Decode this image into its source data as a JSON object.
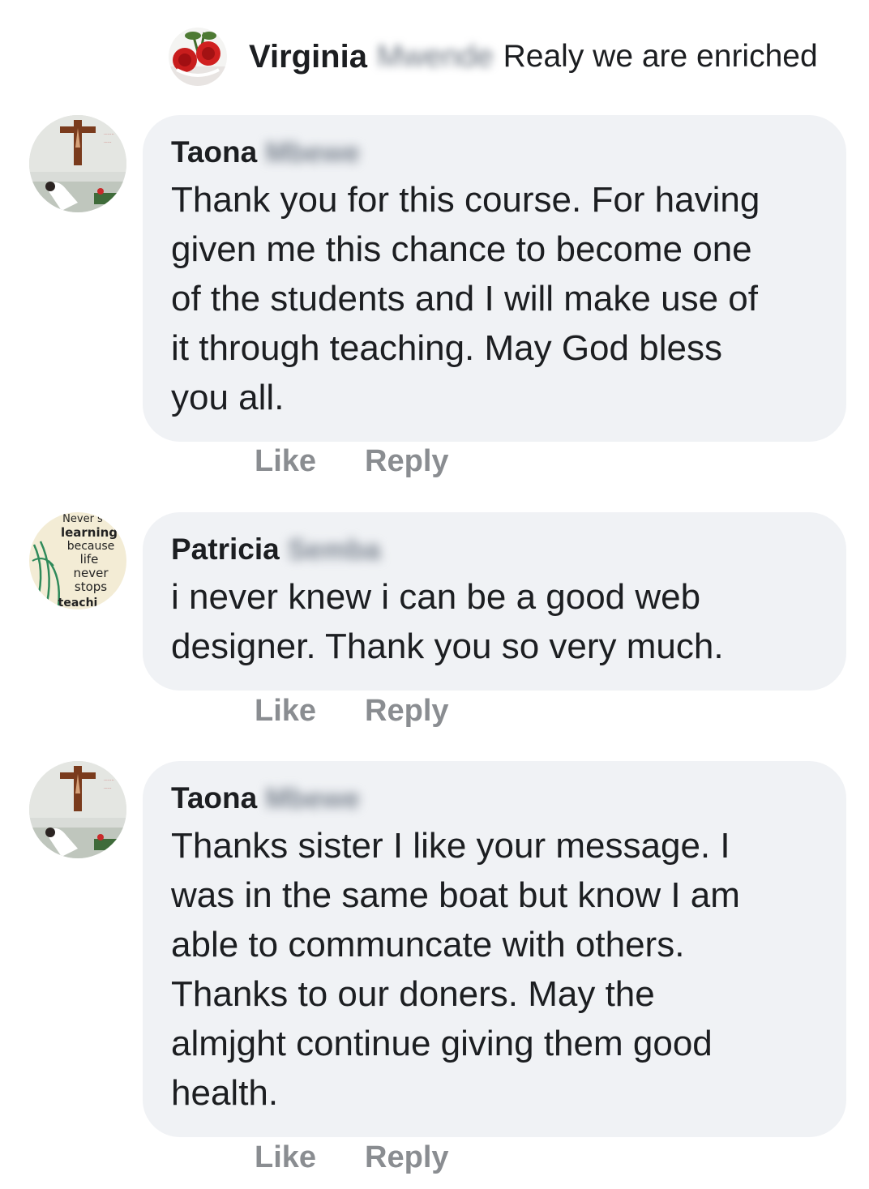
{
  "top_reply": {
    "author_first": "Virginia",
    "author_last": "Mwende",
    "text": "Realy we are enriched",
    "avatar_icon": "roses-avatar-icon"
  },
  "comments": [
    {
      "author_first": "Taona",
      "author_last": "Mbewe",
      "avatar_icon": "crucifix-avatar-icon",
      "text": "Thank you for this course. For having\ngiven me this chance to become one\nof the students and I will make use of\nit through teaching. May God bless\nyou all.",
      "like_label": "Like",
      "reply_label": "Reply"
    },
    {
      "author_first": "Patricia",
      "author_last": "Semba",
      "avatar_icon": "quote-avatar-icon",
      "avatar_lines": [
        "Never s",
        "learning",
        "because",
        "life",
        "never",
        "stops",
        "teachi"
      ],
      "text": "i never knew i can be a good web\ndesigner. Thank you so very much.",
      "like_label": "Like",
      "reply_label": "Reply"
    },
    {
      "author_first": "Taona",
      "author_last": "Mbewe",
      "avatar_icon": "crucifix-avatar-icon",
      "text": "Thanks sister I like your message. I\nwas in the same boat but know I  am\nable to  communcate with others.\nThanks to our doners. May the\nalmjght continue giving them good\nhealth.",
      "like_label": "Like",
      "reply_label": "Reply"
    }
  ],
  "colors": {
    "bubble": "#f0f2f5",
    "action": "#8a8d91",
    "text": "#1c1e21"
  }
}
